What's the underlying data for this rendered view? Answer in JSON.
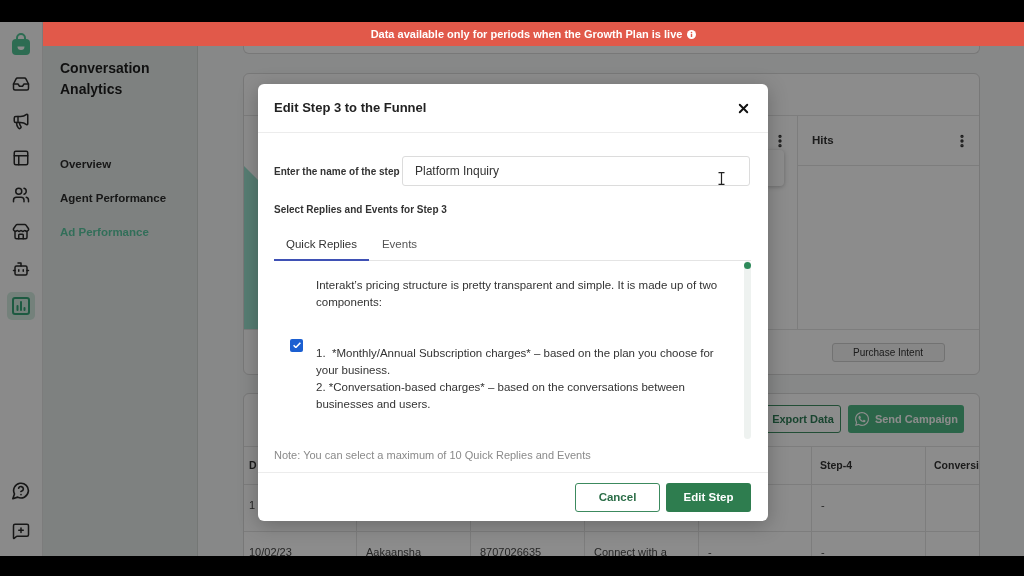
{
  "top_banner": {
    "text": "Data available only for periods when the Growth Plan is live"
  },
  "nav_rail": {
    "items": [
      {
        "kind": "inbox",
        "selected": false
      },
      {
        "kind": "megaphone",
        "selected": false
      },
      {
        "kind": "layout",
        "selected": false
      },
      {
        "kind": "users",
        "selected": false
      },
      {
        "kind": "store",
        "selected": false
      },
      {
        "kind": "bot",
        "selected": false
      },
      {
        "kind": "chart",
        "selected": true
      }
    ],
    "bottom_items": [
      {
        "kind": "help",
        "selected": false
      },
      {
        "kind": "feedback",
        "selected": false
      }
    ]
  },
  "sidebar": {
    "title": "Conversation Analytics",
    "items": [
      {
        "label": "Overview",
        "selected": false
      },
      {
        "label": "Agent Performance",
        "selected": false
      },
      {
        "label": "Ad Performance",
        "selected": true
      }
    ]
  },
  "funnel_card": {
    "column_header": "Hits",
    "step_button": "Purchase Intent"
  },
  "table_card": {
    "buttons": [
      {
        "kind": "export",
        "label": "Export Data"
      },
      {
        "kind": "whatsapp",
        "label": "Send Campaign"
      }
    ],
    "header": {
      "column_1": "D",
      "column_6": "Step-4",
      "column_7": "Conversi"
    },
    "rows": [
      {
        "column_1": "1",
        "column_6": "-"
      },
      {
        "column_1": "10/02/23",
        "column_2": "Aakaansha",
        "column_3": "8707026635",
        "column_4": "Connect with a",
        "column_5": "-",
        "column_6": "-"
      }
    ]
  },
  "modal": {
    "title": "Edit Step 3 to the Funnel",
    "name_label": "Enter the name of the step",
    "name_value": "Platform Inquiry",
    "section_label": "Select Replies and Events for Step 3",
    "tabs": [
      {
        "label": "Quick Replies",
        "selected": true
      },
      {
        "label": "Events",
        "selected": false
      }
    ],
    "replies": [
      {
        "text": "Interakt’s pricing structure is pretty transparent and simple. It is made up of two components:\n\n\n1.  *Monthly/Annual Subscription charges* – based on the plan you choose for your business.\n2. *Conversation-based charges* – based on the conversations between businesses and users.",
        "checked": true
      }
    ],
    "note": "Note: You can select a maximum of 10 Quick Replies and Events",
    "buttons": [
      {
        "kind": "secondary",
        "label": "Cancel"
      },
      {
        "kind": "primary",
        "label": "Edit Step"
      }
    ]
  }
}
